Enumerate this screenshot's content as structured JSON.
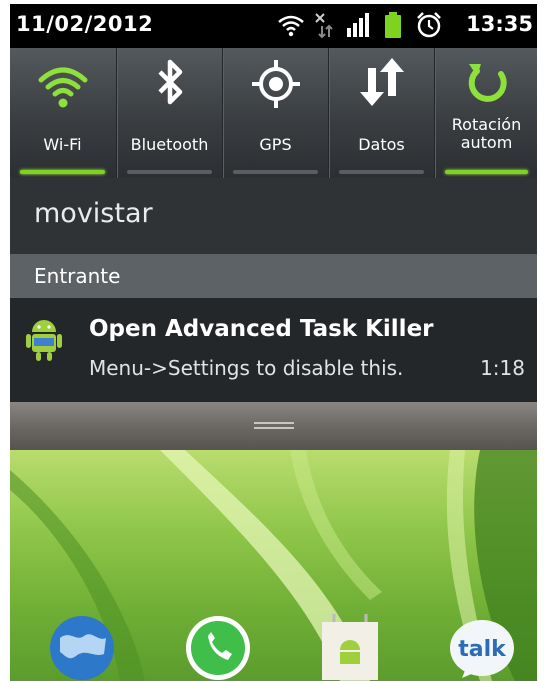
{
  "status_bar": {
    "date": "11/02/2012",
    "time": "13:35",
    "icons": [
      "wifi-signal-icon",
      "data-transfer-icon",
      "cell-signal-icon",
      "battery-icon",
      "alarm-icon"
    ]
  },
  "toggles": [
    {
      "label": "Wi-Fi",
      "icon": "wifi-icon",
      "on": true
    },
    {
      "label": "Bluetooth",
      "icon": "bluetooth-icon",
      "on": false
    },
    {
      "label": "GPS",
      "icon": "gps-icon",
      "on": false
    },
    {
      "label": "Datos",
      "icon": "data-arrows-icon",
      "on": false
    },
    {
      "label": "Rotación autom",
      "icon": "rotation-icon",
      "on": true
    }
  ],
  "carrier": "movistar",
  "section_header": "Entrante",
  "notification": {
    "title": "Open Advanced Task Killer",
    "text": "Menu->Settings to disable this.",
    "time": "1:18",
    "icon": "android-task-killer-icon"
  },
  "dock_icons": [
    "browser-globe-icon",
    "whatsapp-icon",
    "market-icon",
    "talk-icon"
  ],
  "dock_icon_text": {
    "talk": "talk"
  },
  "colors": {
    "toggle_on": "#7ed321",
    "toggle_off": "#5a5e62"
  }
}
